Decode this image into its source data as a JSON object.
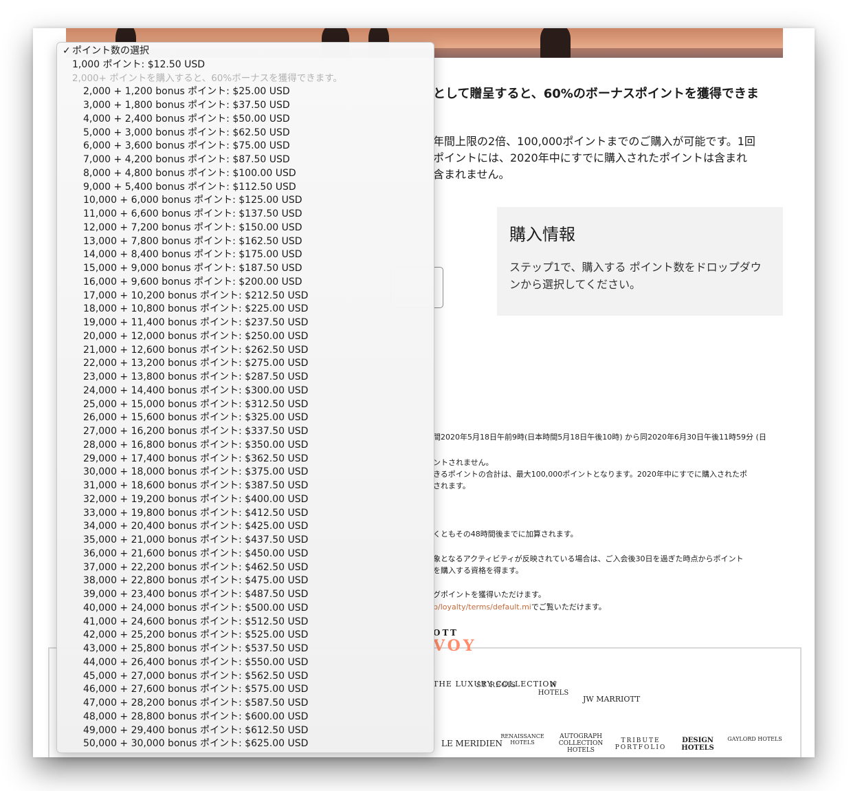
{
  "page": {
    "heading": "として贈呈すると、60%のボーナスポイントを獲得できま",
    "intro_lines": [
      "年間上限の2倍、100,000ポイントまでのご購入が可能です。1回",
      "ポイントには、2020年中にすでに購入されたポイントは含まれ",
      "含まれません。"
    ]
  },
  "purchase_info": {
    "title": "購入情報",
    "body": "ステップ1で、購入する ポイント数をドロップダウンから選択してください。"
  },
  "fine_print": [
    "間2020年5月18日午前9時(日本時間5月18日午後10時) から同2020年6月30日午後11時59分 (日",
    "ントされません。",
    "きるポイントの合計は、最大100,000ポイントとなります。2020年中にすでに購入されたポ",
    "されます。",
    "くともその48時間後までに加算されます。",
    "象となるアクティビティが反映されている場合は、ご入会後30日を過ぎた時点からポイント",
    "を購入する資格を得ます。",
    "グポイントを獲得いただけます。",
    "p/loyalty/terms/default.mi",
    "でご覧いただけます。"
  ],
  "footer": {
    "program_top": "OTT",
    "program_name": "VOY",
    "brands": [
      "THE LUXURY COLLECTION",
      "ST REGIS",
      "W HOTELS",
      "JW MARRIOTT",
      "LE MERIDIEN",
      "RENAISSANCE HOTELS",
      "AUTOGRAPH COLLECTION HOTELS",
      "TRIBUTE PORTFOLIO",
      "DESIGN HOTELS",
      "GAYLORD HOTELS"
    ]
  },
  "dropdown": {
    "selected": "ポイント数の選択",
    "single_option": "1,000 ポイント: $12.50 USD",
    "group_label": "2,000+ ポイントを購入すると、60%ボーナスを獲得できます。",
    "options": [
      "2,000 + 1,200 bonus ポイント: $25.00 USD",
      "3,000 + 1,800 bonus ポイント: $37.50 USD",
      "4,000 + 2,400 bonus ポイント: $50.00 USD",
      "5,000 + 3,000 bonus ポイント: $62.50 USD",
      "6,000 + 3,600 bonus ポイント: $75.00 USD",
      "7,000 + 4,200 bonus ポイント: $87.50 USD",
      "8,000 + 4,800 bonus ポイント: $100.00 USD",
      "9,000 + 5,400 bonus ポイント: $112.50 USD",
      "10,000 + 6,000 bonus ポイント: $125.00 USD",
      "11,000 + 6,600 bonus ポイント: $137.50 USD",
      "12,000 + 7,200 bonus ポイント: $150.00 USD",
      "13,000 + 7,800 bonus ポイント: $162.50 USD",
      "14,000 + 8,400 bonus ポイント: $175.00 USD",
      "15,000 + 9,000 bonus ポイント: $187.50 USD",
      "16,000 + 9,600 bonus ポイント: $200.00 USD",
      "17,000 + 10,200 bonus ポイント: $212.50 USD",
      "18,000 + 10,800 bonus ポイント: $225.00 USD",
      "19,000 + 11,400 bonus ポイント: $237.50 USD",
      "20,000 + 12,000 bonus ポイント: $250.00 USD",
      "21,000 + 12,600 bonus ポイント: $262.50 USD",
      "22,000 + 13,200 bonus ポイント: $275.00 USD",
      "23,000 + 13,800 bonus ポイント: $287.50 USD",
      "24,000 + 14,400 bonus ポイント: $300.00 USD",
      "25,000 + 15,000 bonus ポイント: $312.50 USD",
      "26,000 + 15,600 bonus ポイント: $325.00 USD",
      "27,000 + 16,200 bonus ポイント: $337.50 USD",
      "28,000 + 16,800 bonus ポイント: $350.00 USD",
      "29,000 + 17,400 bonus ポイント: $362.50 USD",
      "30,000 + 18,000 bonus ポイント: $375.00 USD",
      "31,000 + 18,600 bonus ポイント: $387.50 USD",
      "32,000 + 19,200 bonus ポイント: $400.00 USD",
      "33,000 + 19,800 bonus ポイント: $412.50 USD",
      "34,000 + 20,400 bonus ポイント: $425.00 USD",
      "35,000 + 21,000 bonus ポイント: $437.50 USD",
      "36,000 + 21,600 bonus ポイント: $450.00 USD",
      "37,000 + 22,200 bonus ポイント: $462.50 USD",
      "38,000 + 22,800 bonus ポイント: $475.00 USD",
      "39,000 + 23,400 bonus ポイント: $487.50 USD",
      "40,000 + 24,000 bonus ポイント: $500.00 USD",
      "41,000 + 24,600 bonus ポイント: $512.50 USD",
      "42,000 + 25,200 bonus ポイント: $525.00 USD",
      "43,000 + 25,800 bonus ポイント: $537.50 USD",
      "44,000 + 26,400 bonus ポイント: $550.00 USD",
      "45,000 + 27,000 bonus ポイント: $562.50 USD",
      "46,000 + 27,600 bonus ポイント: $575.00 USD",
      "47,000 + 28,200 bonus ポイント: $587.50 USD",
      "48,000 + 28,800 bonus ポイント: $600.00 USD",
      "49,000 + 29,400 bonus ポイント: $612.50 USD",
      "50,000 + 30,000 bonus ポイント: $625.00 USD"
    ]
  }
}
